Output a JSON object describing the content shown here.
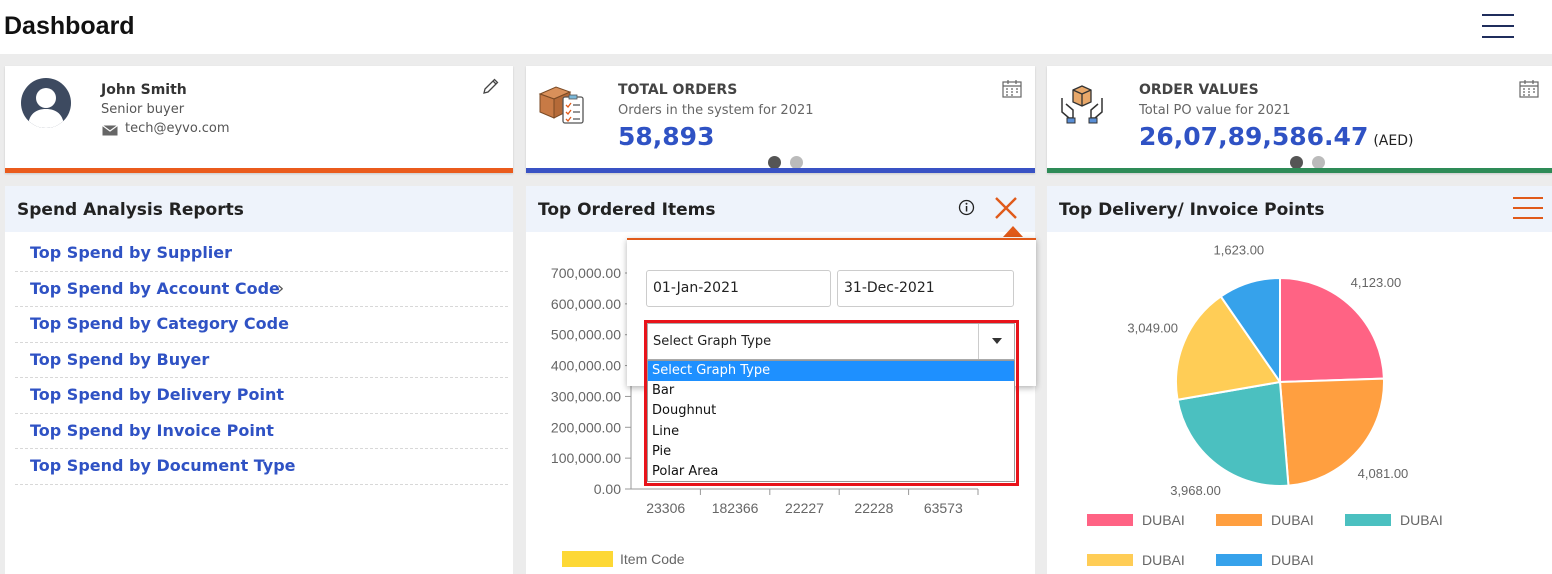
{
  "header": {
    "title": "Dashboard",
    "menu_icon": "hamburger-menu-icon"
  },
  "profile": {
    "name": "John Smith",
    "role": "Senior buyer",
    "email": "tech@eyvo.com",
    "accent": "#ea5b1c"
  },
  "total_orders": {
    "title": "TOTAL ORDERS",
    "subtitle": "Orders in the system for 2021",
    "value": "58,893",
    "accent": "#3952c4"
  },
  "order_values": {
    "title": "ORDER VALUES",
    "subtitle": "Total PO value for 2021",
    "value": "26,07,89,586.47",
    "unit": "(AED)",
    "accent": "#2e8b57"
  },
  "spend_panel": {
    "title": "Spend Analysis Reports",
    "items": [
      "Top Spend by Supplier",
      "Top Spend by Account Code",
      "Top Spend by Category Code",
      "Top Spend by Buyer",
      "Top Spend by Delivery Point",
      "Top Spend by Invoice Point",
      "Top Spend by Document Type"
    ]
  },
  "ordered_panel": {
    "title": "Top Ordered Items",
    "filter": {
      "from_date": "01-Jan-2021",
      "to_date": "31-Dec-2021",
      "graph_type": "Select Graph Type",
      "options": [
        "Select Graph Type",
        "Bar",
        "Doughnut",
        "Line",
        "Pie",
        "Polar Area"
      ]
    }
  },
  "delivery_panel": {
    "title": "Top Delivery/ Invoice Points"
  },
  "chart_data": [
    {
      "type": "bar",
      "categories": [
        "23306",
        "182366",
        "22227",
        "22228",
        "63573"
      ],
      "ylim": [
        0,
        700000
      ],
      "ticks": [
        "0.00",
        "100,000.00",
        "200,000.00",
        "300,000.00",
        "400,000.00",
        "500,000.00",
        "600,000.00",
        "700,000.00"
      ],
      "series": [
        {
          "name": "Item Code",
          "color": "#fdd835"
        }
      ]
    },
    {
      "type": "pie",
      "labels": [
        "DUBAI",
        "DUBAI",
        "DUBAI",
        "DUBAI",
        "DUBAI"
      ],
      "values": [
        4123,
        4081,
        3968,
        3049,
        1623
      ],
      "value_labels": [
        "4,123.00",
        "4,081.00",
        "3,968.00",
        "3,049.00",
        "1,623.00"
      ],
      "colors": [
        "#ff6384",
        "#ff9f40",
        "#4bc0c0",
        "#ffcd56",
        "#36a2eb"
      ]
    }
  ]
}
